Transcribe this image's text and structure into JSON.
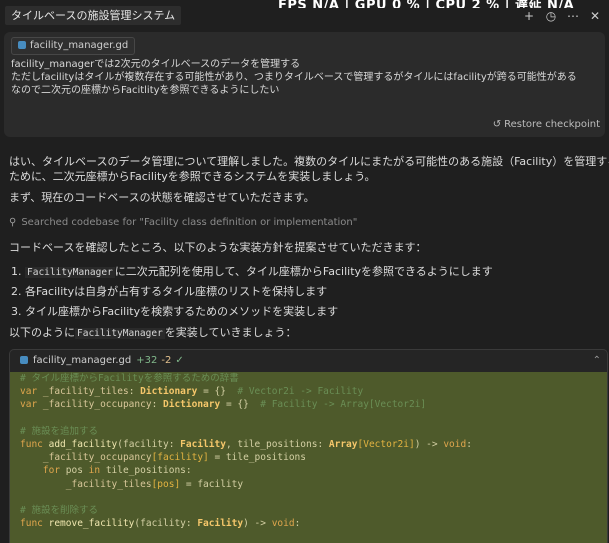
{
  "header": {
    "title": "タイルベースの施設管理システム",
    "overlay_text": "FPS  N/A  |  GPU  0 %  |  CPU  2 %  |  遅延  N/A",
    "icons": [
      "plus-icon",
      "history-icon",
      "more-icon",
      "close-icon"
    ]
  },
  "user_message": {
    "file_chip": "facility_manager.gd",
    "lines": [
      "facility_managerでは2次元のタイルベースのデータを管理する",
      "ただしfacilityはタイルが複数存在する可能性があり、つまりタイルベースで管理するがタイルにはfacilityが跨る可能性がある",
      "なので二次元の座標からFacitlityを参照できるようにしたい"
    ],
    "restore_label": "Restore checkpoint"
  },
  "assistant": {
    "intro_lines": [
      "はい、タイルベースのデータ管理について理解しました。複数のタイルにまたがる可能性のある施設（Facility）を管理する",
      "ために、二次元座標からFacilityを参照できるシステムを実装しましょう。"
    ],
    "check_line": "まず、現在のコードベースの状態を確認させていただきます。",
    "searched": "Searched codebase for \"Facility class definition or implementation\"",
    "plan_intro": "コードベースを確認したところ、以下のような実装方針を提案させていただきます：",
    "list": [
      {
        "num": "1.",
        "code": "FacilityManager",
        "text": "に二次元配列を使用して、タイル座標からFacilityを参照できるようにします"
      },
      {
        "num": "2.",
        "text": "各Facilityは自身が占有するタイル座標のリストを保持します"
      },
      {
        "num": "3.",
        "text": "タイル座標からFacilityを検索するためのメソッドを実装します"
      }
    ],
    "implement_pre": "以下のように",
    "implement_code": "FacilityManager",
    "implement_post": "を実装していきましょう："
  },
  "code_card": {
    "filename": "facility_manager.gd",
    "added": "+32",
    "removed": "-2",
    "lines": [
      [
        [
          "c-com",
          "# タイル座標からFacilityを参照するための辞書"
        ]
      ],
      [
        [
          "c-kw",
          "var"
        ],
        [
          "c-var",
          " _facility_tiles"
        ],
        [
          "c-pun",
          ": "
        ],
        [
          "c-type",
          "Dictionary"
        ],
        [
          "c-pun",
          " = {}  "
        ],
        [
          "c-com",
          "# Vector2i -> Facility"
        ]
      ],
      [
        [
          "c-kw",
          "var"
        ],
        [
          "c-var",
          " _facility_occupancy"
        ],
        [
          "c-pun",
          ": "
        ],
        [
          "c-type",
          "Dictionary"
        ],
        [
          "c-pun",
          " = {}  "
        ],
        [
          "c-com",
          "# Facility -> Array[Vector2i]"
        ]
      ],
      [],
      [
        [
          "c-com",
          "# 施設を追加する"
        ]
      ],
      [
        [
          "c-kw",
          "func"
        ],
        [
          "c-fn",
          " add_facility"
        ],
        [
          "c-pun",
          "(facility: "
        ],
        [
          "c-type",
          "Facility"
        ],
        [
          "c-pun",
          ", tile_positions: "
        ],
        [
          "c-type",
          "Array"
        ],
        [
          "c-br",
          "[Vector2i]"
        ],
        [
          "c-pun",
          ") -> "
        ],
        [
          "c-kw",
          "void"
        ],
        [
          "c-pun",
          ":"
        ]
      ],
      [
        [
          "c-var",
          "    _facility_occupancy"
        ],
        [
          "c-br",
          "[facility]"
        ],
        [
          "c-pun",
          " = tile_positions"
        ]
      ],
      [
        [
          "c-kw",
          "    for"
        ],
        [
          "c-pun",
          " pos "
        ],
        [
          "c-kw",
          "in"
        ],
        [
          "c-pun",
          " tile_positions:"
        ]
      ],
      [
        [
          "c-var",
          "        _facility_tiles"
        ],
        [
          "c-br",
          "[pos]"
        ],
        [
          "c-pun",
          " = facility"
        ]
      ],
      [],
      [
        [
          "c-com",
          "# 施設を削除する"
        ]
      ],
      [
        [
          "c-kw",
          "func"
        ],
        [
          "c-fn",
          " remove_facility"
        ],
        [
          "c-pun",
          "(facility: "
        ],
        [
          "c-type",
          "Facility"
        ],
        [
          "c-pun",
          ") -> "
        ],
        [
          "c-kw",
          "void"
        ],
        [
          "c-pun",
          ":"
        ]
      ]
    ]
  },
  "colors": {
    "background": "#1f1f1f",
    "message_box": "#2b2b2b",
    "code_diff_added": "#4e5a2b",
    "keyword": "#e0a64d",
    "comment": "#6a8e55"
  }
}
